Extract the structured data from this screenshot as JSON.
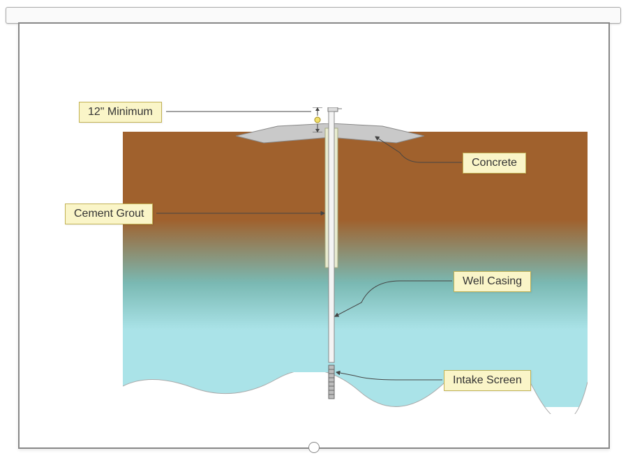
{
  "labels": {
    "minimum": "12\" Minimum",
    "concrete": "Concrete",
    "grout": "Cement Grout",
    "casing": "Well Casing",
    "intake": "Intake Screen"
  },
  "colors": {
    "soil_top": "#a0612d",
    "water": "#aae3e8",
    "label_bg": "#faf5c8",
    "label_border": "#c2b255",
    "concrete": "#c9c9c9"
  }
}
